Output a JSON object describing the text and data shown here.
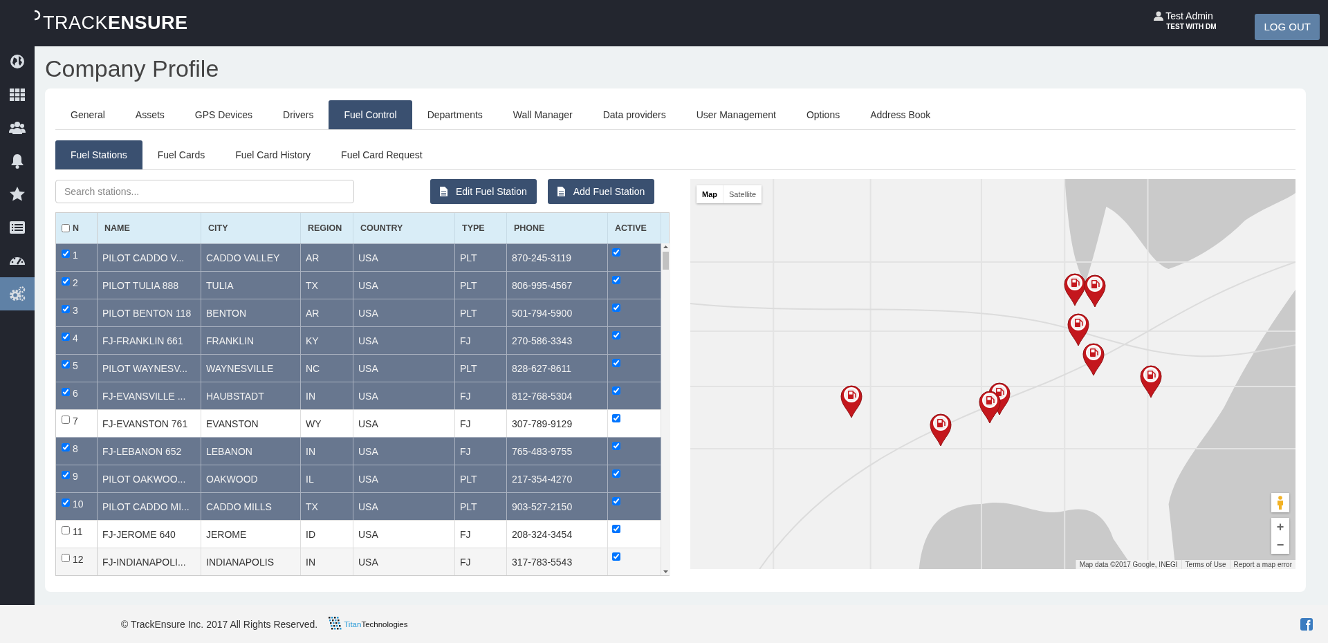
{
  "header": {
    "logo": "TRACK**ENSURE**",
    "user_name": "Test Admin",
    "user_company": "TEST WITH DM",
    "logout": "LOG OUT"
  },
  "sidebar": {
    "items": [
      {
        "kind": "globe",
        "selected": false
      },
      {
        "kind": "grid",
        "selected": false
      },
      {
        "kind": "users",
        "selected": false
      },
      {
        "kind": "bell",
        "selected": false
      },
      {
        "kind": "star",
        "selected": false
      },
      {
        "kind": "list",
        "selected": false
      },
      {
        "kind": "gauge",
        "selected": false
      },
      {
        "kind": "gears",
        "selected": true
      }
    ]
  },
  "page_title": "Company Profile",
  "tabs": [
    {
      "label": "General",
      "selected": false
    },
    {
      "label": "Assets",
      "selected": false
    },
    {
      "label": "GPS Devices",
      "selected": false
    },
    {
      "label": "Drivers",
      "selected": false
    },
    {
      "label": "Fuel Control",
      "selected": true
    },
    {
      "label": "Departments",
      "selected": false
    },
    {
      "label": "Wall Manager",
      "selected": false
    },
    {
      "label": "Data providers",
      "selected": false
    },
    {
      "label": "User Management",
      "selected": false
    },
    {
      "label": "Options",
      "selected": false
    },
    {
      "label": "Address Book",
      "selected": false
    }
  ],
  "subtabs": [
    {
      "label": "Fuel Stations",
      "selected": true
    },
    {
      "label": "Fuel Cards",
      "selected": false
    },
    {
      "label": "Fuel Card History",
      "selected": false
    },
    {
      "label": "Fuel Card Request",
      "selected": false
    }
  ],
  "search": {
    "placeholder": "Search stations..."
  },
  "buttons": [
    "Edit Fuel Station",
    "Add Fuel Station"
  ],
  "table": {
    "select_all": {
      "checked": false
    },
    "columns": [
      "N",
      "NAME",
      "CITY",
      "REGION",
      "COUNTRY",
      "TYPE",
      "PHONE",
      "ACTIVE"
    ],
    "rows": [
      {
        "n": "1",
        "name": "PILOT CADDO V...",
        "city": "CADDO VALLEY",
        "region": "AR",
        "country": "USA",
        "type": "PLT",
        "phone": "870-245-3119",
        "selected": true,
        "active": true
      },
      {
        "n": "2",
        "name": "PILOT TULIA 888",
        "city": "TULIA",
        "region": "TX",
        "country": "USA",
        "type": "PLT",
        "phone": "806-995-4567",
        "selected": true,
        "active": true
      },
      {
        "n": "3",
        "name": "PILOT BENTON 118",
        "city": "BENTON",
        "region": "AR",
        "country": "USA",
        "type": "PLT",
        "phone": "501-794-5900",
        "selected": true,
        "active": true
      },
      {
        "n": "4",
        "name": "FJ-FRANKLIN 661",
        "city": "FRANKLIN",
        "region": "KY",
        "country": "USA",
        "type": "FJ",
        "phone": "270-586-3343",
        "selected": true,
        "active": true
      },
      {
        "n": "5",
        "name": "PILOT WAYNESV...",
        "city": "WAYNESVILLE",
        "region": "NC",
        "country": "USA",
        "type": "PLT",
        "phone": "828-627-8611",
        "selected": true,
        "active": true
      },
      {
        "n": "6",
        "name": "FJ-EVANSVILLE ...",
        "city": "HAUBSTADT",
        "region": "IN",
        "country": "USA",
        "type": "FJ",
        "phone": "812-768-5304",
        "selected": true,
        "active": true
      },
      {
        "n": "7",
        "name": "FJ-EVANSTON 761",
        "city": "EVANSTON",
        "region": "WY",
        "country": "USA",
        "type": "FJ",
        "phone": "307-789-9129",
        "selected": false,
        "active": true
      },
      {
        "n": "8",
        "name": "FJ-LEBANON 652",
        "city": "LEBANON",
        "region": "IN",
        "country": "USA",
        "type": "FJ",
        "phone": "765-483-9755",
        "selected": true,
        "active": true
      },
      {
        "n": "9",
        "name": "PILOT OAKWOO...",
        "city": "OAKWOOD",
        "region": "IL",
        "country": "USA",
        "type": "PLT",
        "phone": "217-354-4270",
        "selected": true,
        "active": true
      },
      {
        "n": "10",
        "name": "PILOT CADDO MI...",
        "city": "CADDO MILLS",
        "region": "TX",
        "country": "USA",
        "type": "PLT",
        "phone": "903-527-2150",
        "selected": true,
        "active": true
      },
      {
        "n": "11",
        "name": "FJ-JEROME 640",
        "city": "JEROME",
        "region": "ID",
        "country": "USA",
        "type": "FJ",
        "phone": "208-324-3454",
        "selected": false,
        "active": true
      },
      {
        "n": "12",
        "name": "FJ-INDIANAPOLI...",
        "city": "INDIANAPOLIS",
        "region": "IN",
        "country": "USA",
        "type": "FJ",
        "phone": "317-783-5543",
        "selected": false,
        "active": true
      }
    ]
  },
  "map": {
    "kind": "picture",
    "type_buttons": [
      {
        "label": "Map",
        "selected": true
      },
      {
        "label": "Satellite",
        "selected": false
      }
    ],
    "zoom_in": "+",
    "zoom_out": "−",
    "attribution": [
      "Map data ©2017 Google, INEGI",
      "Terms of Use",
      "Report a map error"
    ]
  },
  "footer": {
    "copyright": "© TrackEnsure Inc. 2017 All Rights Reserved.",
    "partner_a": "Titan",
    "partner_b": "Technologies"
  }
}
